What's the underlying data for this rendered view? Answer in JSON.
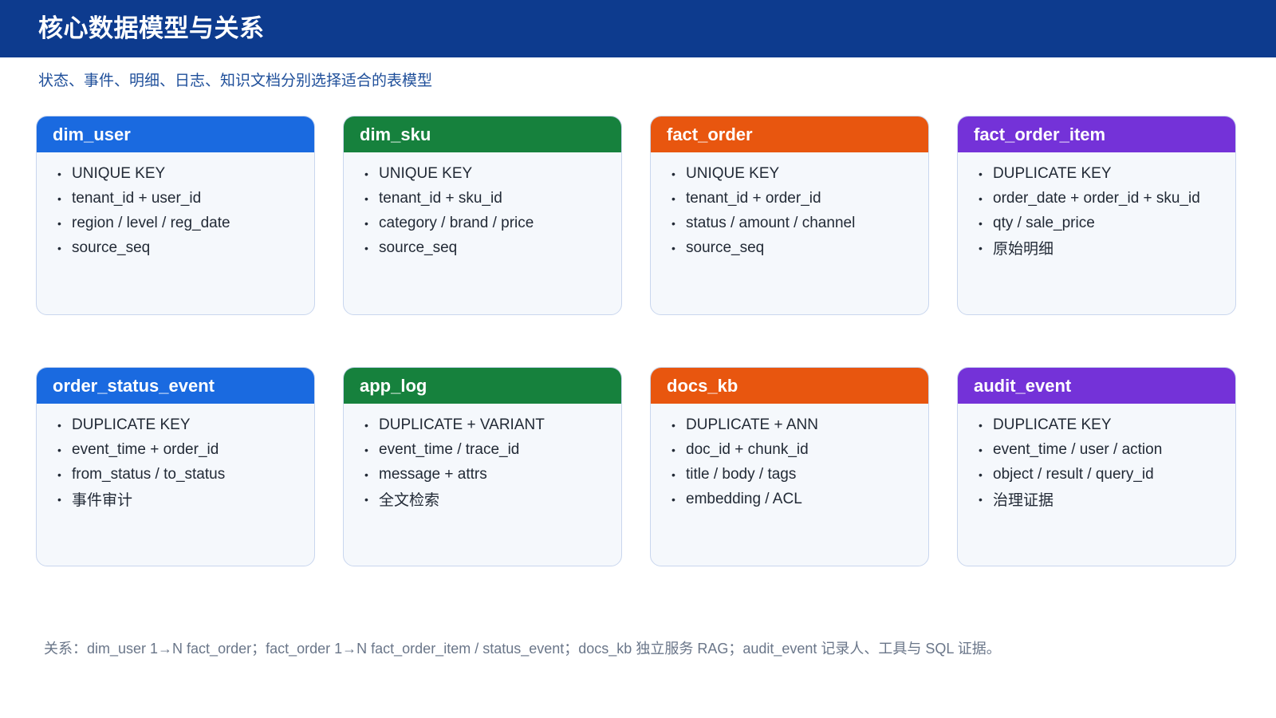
{
  "header": {
    "title": "核心数据模型与关系"
  },
  "subtitle": "状态、事件、明细、日志、知识文档分别选择适合的表模型",
  "colors": {
    "header_bg": "#0d3b8e",
    "blue": "#1a6ae0",
    "green": "#16813d",
    "orange": "#e8560f",
    "purple": "#7432d8"
  },
  "cards": [
    {
      "title": "dim_user",
      "color": "#1a6ae0",
      "items": [
        "UNIQUE KEY",
        "tenant_id + user_id",
        "region / level / reg_date",
        "source_seq"
      ]
    },
    {
      "title": "dim_sku",
      "color": "#16813d",
      "items": [
        "UNIQUE KEY",
        "tenant_id + sku_id",
        "category / brand / price",
        "source_seq"
      ]
    },
    {
      "title": "fact_order",
      "color": "#e8560f",
      "items": [
        "UNIQUE KEY",
        "tenant_id + order_id",
        "status / amount / channel",
        "source_seq"
      ]
    },
    {
      "title": "fact_order_item",
      "color": "#7432d8",
      "items": [
        "DUPLICATE KEY",
        "order_date + order_id + sku_id",
        "qty / sale_price",
        "原始明细"
      ]
    },
    {
      "title": "order_status_event",
      "color": "#1a6ae0",
      "items": [
        "DUPLICATE KEY",
        "event_time + order_id",
        "from_status / to_status",
        "事件审计"
      ]
    },
    {
      "title": "app_log",
      "color": "#16813d",
      "items": [
        "DUPLICATE + VARIANT",
        "event_time / trace_id",
        "message + attrs",
        "全文检索"
      ]
    },
    {
      "title": "docs_kb",
      "color": "#e8560f",
      "items": [
        "DUPLICATE + ANN",
        "doc_id + chunk_id",
        "title / body / tags",
        "embedding / ACL"
      ]
    },
    {
      "title": "audit_event",
      "color": "#7432d8",
      "items": [
        "DUPLICATE KEY",
        "event_time / user / action",
        "object / result / query_id",
        "治理证据"
      ]
    }
  ],
  "footer": {
    "relations": "关系：dim_user 1→N fact_order；fact_order 1→N fact_order_item / status_event；docs_kb 独立服务 RAG；audit_event 记录人、工具与 SQL 证据。"
  }
}
